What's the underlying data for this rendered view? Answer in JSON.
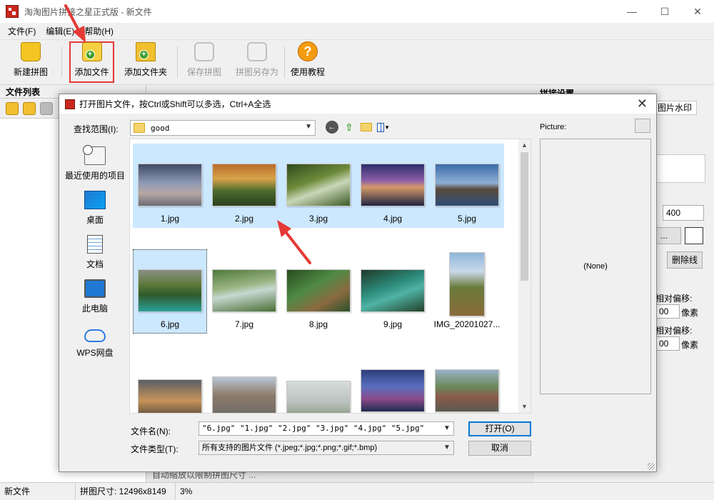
{
  "window": {
    "title": "淘淘图片拼接之星正式版 - 新文件"
  },
  "menu": [
    "文件(F)",
    "编辑(E)",
    "帮助(H)"
  ],
  "toolbar": {
    "new": "新建拼图",
    "add_file": "添加文件",
    "add_folder": "添加文件夹",
    "save": "保存拼图",
    "save_as": "拼图另存为",
    "help": "使用教程"
  },
  "left_panel": {
    "title": "文件列表"
  },
  "right_panel": {
    "title": "拼接设置",
    "tab": "图片水印",
    "size_value": "400",
    "button_left": "...",
    "button_delete": "删除线",
    "offset_label_1": "相对偏移:",
    "offset_value_1": "00",
    "unit_1": "像素",
    "offset_label_2": "相对偏移:",
    "offset_value_2": "00",
    "unit_2": "像素"
  },
  "bottom_strip": "自动缩放以限制拼图尺寸  ...",
  "status": {
    "file": "新文件",
    "size": "拼图尺寸: 12496x8149",
    "zoom": "3%"
  },
  "dialog": {
    "title": "打开图片文件，按Ctrl或Shift可以多选，Ctrl+A全选",
    "look_in_label": "查找范围(I):",
    "look_in_value": "good",
    "places": [
      "最近使用的项目",
      "桌面",
      "文档",
      "此电脑",
      "WPS网盘"
    ],
    "files": [
      {
        "name": "1.jpg",
        "selected": true
      },
      {
        "name": "2.jpg",
        "selected": true
      },
      {
        "name": "3.jpg",
        "selected": true
      },
      {
        "name": "4.jpg",
        "selected": true
      },
      {
        "name": "5.jpg",
        "selected": true
      },
      {
        "name": "6.jpg",
        "selected": true
      },
      {
        "name": "7.jpg",
        "selected": false
      },
      {
        "name": "8.jpg",
        "selected": false
      },
      {
        "name": "9.jpg",
        "selected": false
      },
      {
        "name": "IMG_20201027...",
        "selected": false
      }
    ],
    "filename_label": "文件名(N):",
    "filename_value": "\"6.jpg\" \"1.jpg\" \"2.jpg\" \"3.jpg\" \"4.jpg\" \"5.jpg\"",
    "filetype_label": "文件类型(T):",
    "filetype_value": "所有支持的图片文件 (*.jpeg;*.jpg;*.png;*.gif;*.bmp)",
    "open_button": "打开(O)",
    "cancel_button": "取消",
    "picture_label": "Picture:",
    "preview_text": "(None)"
  },
  "colors": {
    "selection": "#cce8ff",
    "annotation_arrow": "#e53935",
    "highlight_border": "#e53935"
  }
}
